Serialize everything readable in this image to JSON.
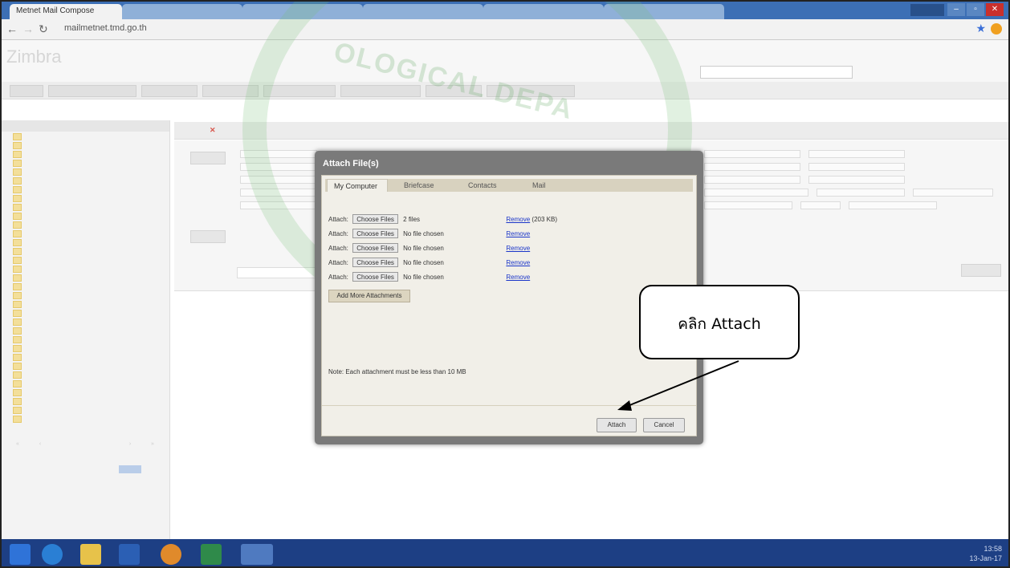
{
  "browser": {
    "tabs": [
      {
        "label": "Metnet Mail Compose",
        "active": true
      },
      {
        "label": "",
        "active": false
      },
      {
        "label": "",
        "active": false
      },
      {
        "label": "",
        "active": false
      },
      {
        "label": "",
        "active": false
      },
      {
        "label": "",
        "active": false
      }
    ],
    "url": "mailmetnet.tmd.go.th",
    "window_buttons": [
      "–",
      "▫",
      "✕"
    ]
  },
  "app": {
    "logo": "Zimbra"
  },
  "compose": {
    "toolbar_close_icon": "close-icon"
  },
  "dialog": {
    "title": "Attach File(s)",
    "tabs": [
      "My Computer",
      "Briefcase",
      "Contacts",
      "Mail"
    ],
    "rows": [
      {
        "label": "Attach:",
        "button": "Choose Files",
        "file": "2 files",
        "remove": "Remove",
        "size": "(203 KB)"
      },
      {
        "label": "Attach:",
        "button": "Choose Files",
        "file": "No file chosen",
        "remove": "Remove",
        "size": ""
      },
      {
        "label": "Attach:",
        "button": "Choose Files",
        "file": "No file chosen",
        "remove": "Remove",
        "size": ""
      },
      {
        "label": "Attach:",
        "button": "Choose Files",
        "file": "No file chosen",
        "remove": "Remove",
        "size": ""
      },
      {
        "label": "Attach:",
        "button": "Choose Files",
        "file": "No file chosen",
        "remove": "Remove",
        "size": ""
      }
    ],
    "add_more": "Add More Attachments",
    "note": "Note: Each attachment must be less than 10 MB",
    "attach_button": "Attach",
    "cancel_button": "Cancel"
  },
  "callout": {
    "text": "คลิก Attach"
  },
  "taskbar": {
    "time": "13:58",
    "date": "13-Jan-17"
  }
}
